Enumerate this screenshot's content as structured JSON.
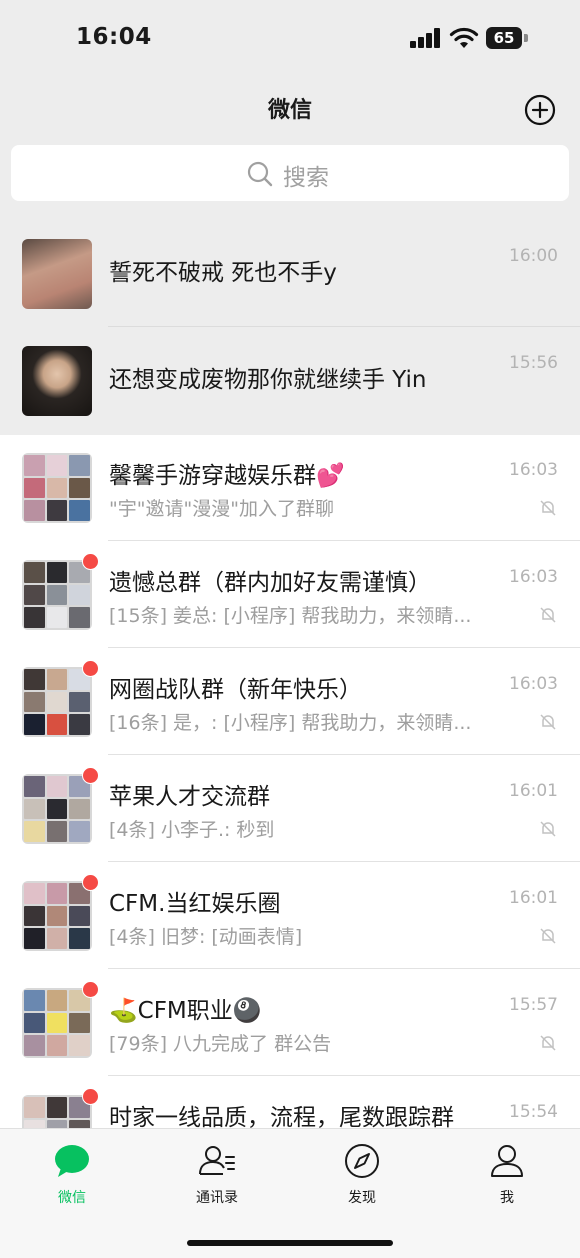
{
  "status_bar": {
    "time": "16:04",
    "battery": "65"
  },
  "header": {
    "title": "微信"
  },
  "search": {
    "placeholder": "搜索"
  },
  "chats": [
    {
      "name": "誓死不破戒 死也不手y",
      "time": "16:00",
      "preview": "",
      "pinned": true
    },
    {
      "name": "还想变成废物那你就继续手 Yin",
      "time": "15:56",
      "preview": "",
      "pinned": true
    },
    {
      "name": "馨馨手游穿越娱乐群💕",
      "time": "16:03",
      "preview": "\"宇\"邀请\"漫漫\"加入了群聊",
      "muted": true
    },
    {
      "name": "遗憾总群（群内加好友需谨慎）",
      "time": "16:03",
      "preview": "[15条] 姜总: [小程序] 帮我助力，来领睛...",
      "muted": true,
      "unread_dot": true
    },
    {
      "name": "网圈战队群（新年快乐）",
      "time": "16:03",
      "preview": "[16条] 是，: [小程序] 帮我助力，来领睛...",
      "muted": true,
      "unread_dot": true
    },
    {
      "name": "苹果人才交流群",
      "time": "16:01",
      "preview": "[4条] 小李子.: 秒到",
      "muted": true,
      "unread_dot": true
    },
    {
      "name": "CFM.当红娱乐圈",
      "time": "16:01",
      "preview": "[4条] 旧梦: [动画表情]",
      "muted": true,
      "unread_dot": true
    },
    {
      "name": "⛳CFM职业🎱",
      "time": "15:57",
      "preview": "[79条] 八九完成了 群公告",
      "muted": true,
      "unread_dot": true
    },
    {
      "name": "时家一线品质，流程，尾数跟踪群",
      "time": "15:54",
      "preview": "",
      "muted": true,
      "unread_dot": true
    }
  ],
  "tabs": [
    {
      "label": "微信",
      "icon": "chat-bubble-icon",
      "active": true
    },
    {
      "label": "通讯录",
      "icon": "contacts-icon"
    },
    {
      "label": "发现",
      "icon": "compass-icon"
    },
    {
      "label": "我",
      "icon": "person-icon"
    }
  ],
  "colors": {
    "accent": "#07c160",
    "badge": "#f54a45",
    "pinned_bg": "#ededed"
  }
}
